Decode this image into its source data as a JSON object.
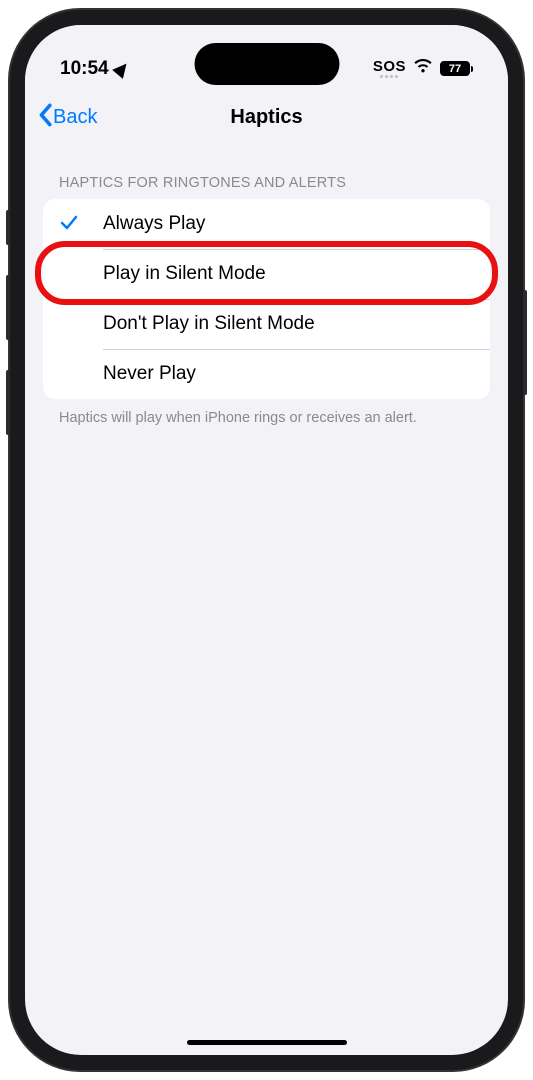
{
  "status": {
    "time": "10:54",
    "sos": "SOS",
    "battery": "77"
  },
  "nav": {
    "back": "Back",
    "title": "Haptics"
  },
  "section": {
    "header": "HAPTICS FOR RINGTONES AND ALERTS",
    "footer": "Haptics will play when iPhone rings or receives an alert."
  },
  "options": [
    {
      "label": "Always Play",
      "selected": true
    },
    {
      "label": "Play in Silent Mode",
      "selected": false
    },
    {
      "label": "Don't Play in Silent Mode",
      "selected": false
    },
    {
      "label": "Never Play",
      "selected": false
    }
  ],
  "highlighted_index": 1
}
